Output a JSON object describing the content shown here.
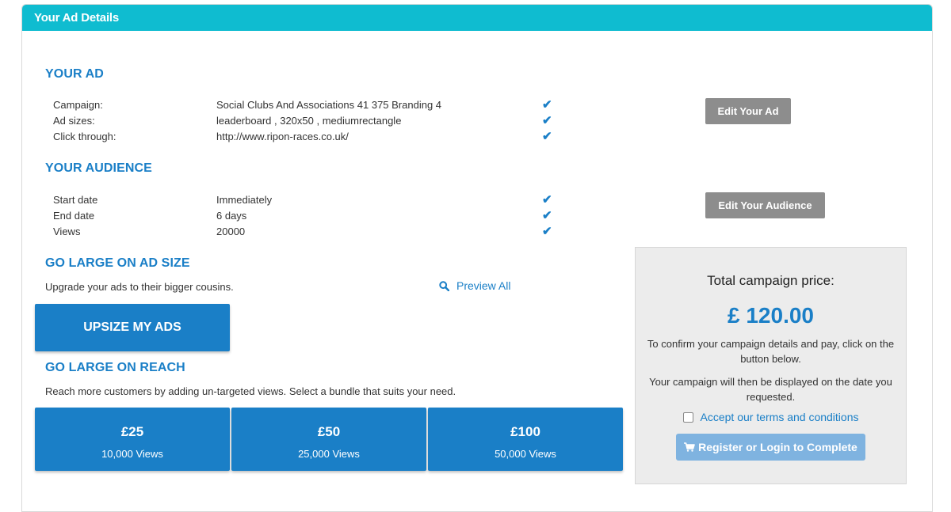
{
  "panel": {
    "title": "Your Ad Details"
  },
  "your_ad": {
    "title": "YOUR AD",
    "rows": [
      {
        "label": "Campaign:",
        "value": "Social Clubs And Associations 41 375 Branding 4"
      },
      {
        "label": "Ad sizes:",
        "value": "leaderboard , 320x50 , mediumrectangle"
      },
      {
        "label": "Click through:",
        "value": "http://www.ripon-races.co.uk/"
      }
    ],
    "edit_button": "Edit Your Ad"
  },
  "your_audience": {
    "title": "YOUR AUDIENCE",
    "rows": [
      {
        "label": "Start date",
        "value": "Immediately"
      },
      {
        "label": "End date",
        "value": "6 days"
      },
      {
        "label": "Views",
        "value": "20000"
      }
    ],
    "edit_button": "Edit Your Audience"
  },
  "check_glyph": "✔",
  "ad_size": {
    "title": "GO LARGE ON AD SIZE",
    "description": "Upgrade your ads to their bigger cousins.",
    "preview_link": "Preview All",
    "upsize_button": "UPSIZE MY ADS"
  },
  "reach": {
    "title": "GO LARGE ON REACH",
    "description": "Reach more customers by adding un-targeted views. Select a bundle that suits your need.",
    "bundles": [
      {
        "price": "£25",
        "views": "10,000 Views"
      },
      {
        "price": "£50",
        "views": "25,000 Views"
      },
      {
        "price": "£100",
        "views": "50,000 Views"
      }
    ]
  },
  "summary": {
    "heading": "Total campaign price:",
    "price": "£ 120.00",
    "confirm_text": "To confirm your campaign details and pay, click on the button below.",
    "display_text": "Your campaign will then be displayed on the date you requested.",
    "terms_label": "Accept our terms and conditions",
    "register_button": "Register or Login to Complete"
  },
  "colors": {
    "header": "#0fbcd0",
    "accent": "#1a7fc7",
    "grey_button": "#8d8d8d",
    "register": "#7fb3e0"
  }
}
